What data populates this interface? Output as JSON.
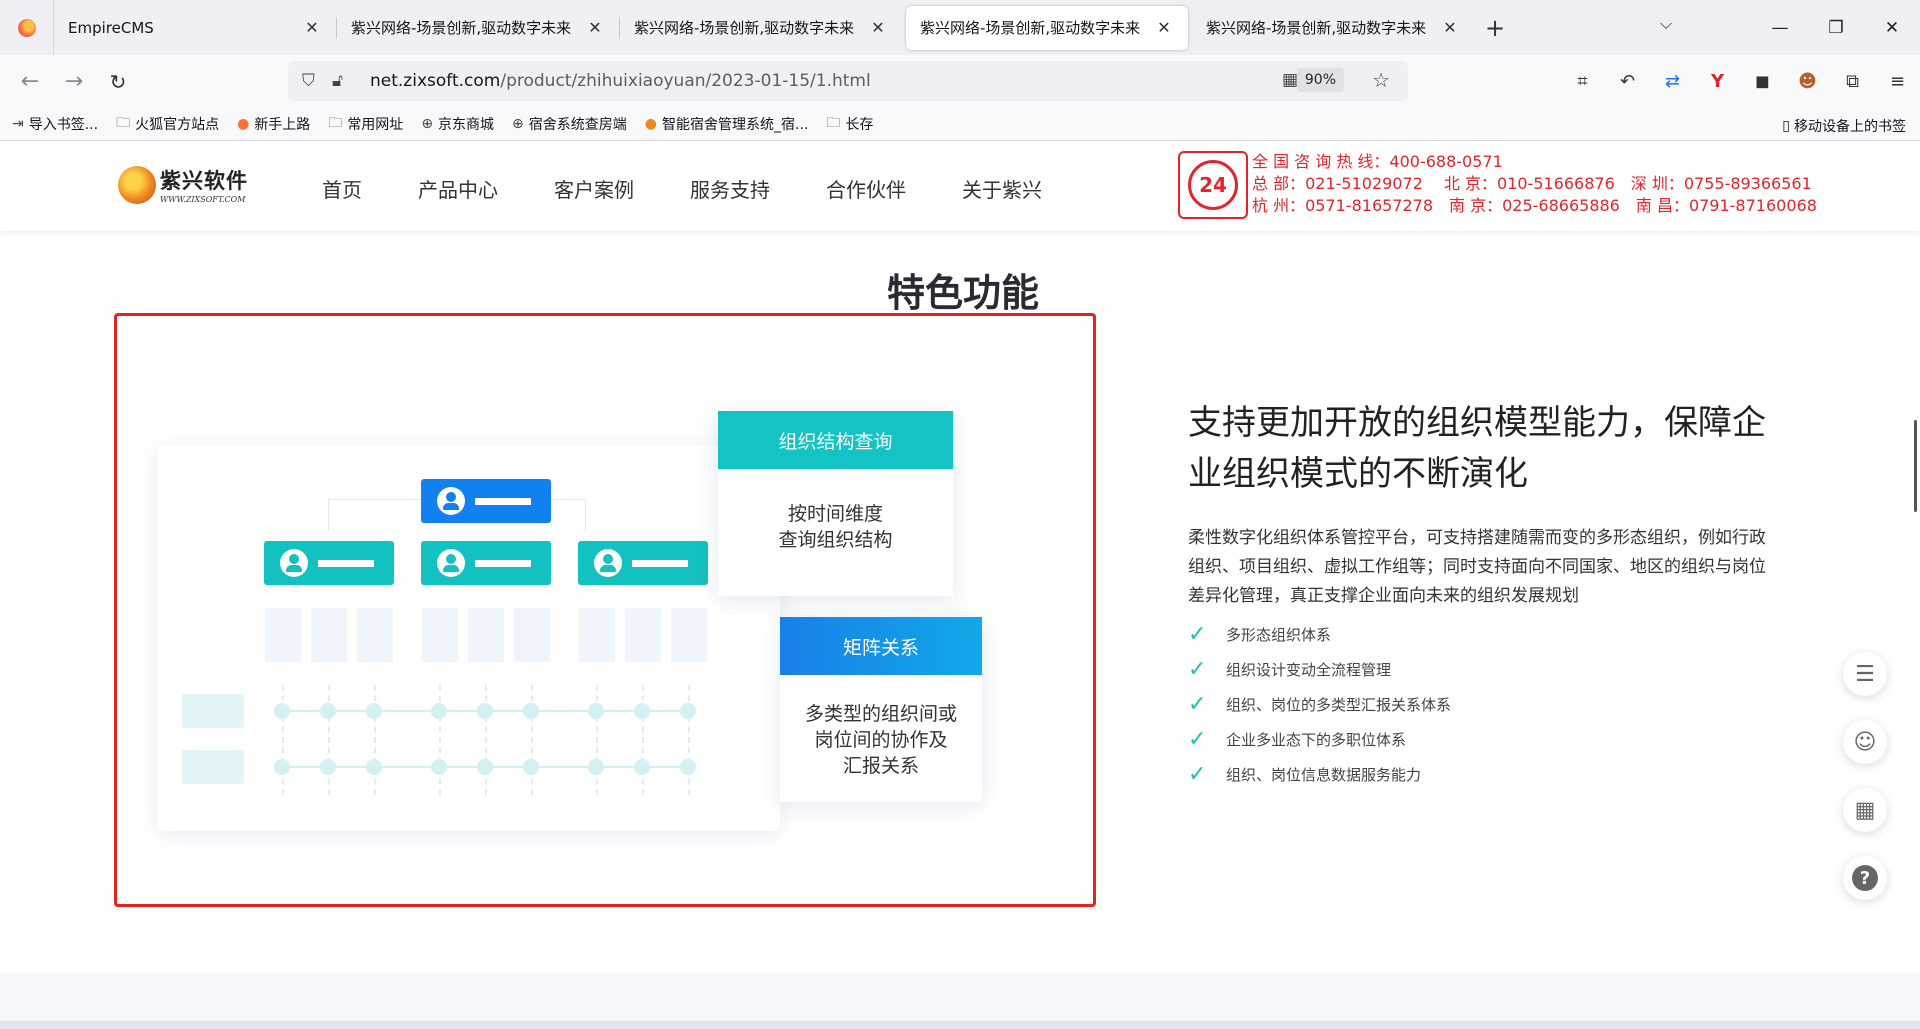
{
  "browser": {
    "tabs": [
      {
        "label": "EmpireCMS",
        "active": false
      },
      {
        "label": "紫兴网络-场景创新,驱动数字未来",
        "active": false
      },
      {
        "label": "紫兴网络-场景创新,驱动数字未来",
        "active": false
      },
      {
        "label": "紫兴网络-场景创新,驱动数字未来",
        "active": true
      },
      {
        "label": "紫兴网络-场景创新,驱动数字未来",
        "active": false
      }
    ],
    "url_host": "net.zixsoft.com",
    "url_path": "/product/zhihuixiaoyuan/2023-01-15/1.html",
    "zoom": "90%",
    "bookmarks": [
      {
        "label": "导入书签...",
        "icon": "import-icon"
      },
      {
        "label": "火狐官方站点",
        "icon": "folder-icon"
      },
      {
        "label": "新手上路",
        "icon": "firefox-icon"
      },
      {
        "label": "常用网址",
        "icon": "folder-icon"
      },
      {
        "label": "京东商城",
        "icon": "globe-icon"
      },
      {
        "label": "宿舍系统查房端",
        "icon": "globe-icon"
      },
      {
        "label": "智能宿舍管理系统_宿...",
        "icon": "site-icon"
      },
      {
        "label": "长存",
        "icon": "folder-icon"
      }
    ],
    "mobile_bookmarks": "移动设备上的书签"
  },
  "header": {
    "logo_cn": "紫兴软件",
    "logo_en": "WWW.ZIXSOFT.COM",
    "nav": [
      "首页",
      "产品中心",
      "客户案例",
      "服务支持",
      "合作伙伴",
      "关于紫兴"
    ],
    "hotline_badge": "24",
    "hotline": [
      "全 国 咨 询 热 线：400-688-0571",
      "总 部：021-51029072　 北 京：010-51666876　深 圳：0755-89366561",
      "杭 州：0571-81657278　南 京：025-68665886　南 昌：0791-87160068"
    ]
  },
  "section": {
    "title": "特色功能",
    "card1": {
      "title": "组织结构查询",
      "body_line1": "按时间维度",
      "body_line2": "查询组织结构"
    },
    "card2": {
      "title": "矩阵关系",
      "body_line1": "多类型的组织间或",
      "body_line2": "岗位间的协作及",
      "body_line3": "汇报关系"
    },
    "heading": "支持更加开放的组织模型能力，保障企业组织模式的不断演化",
    "description": "柔性数字化组织体系管控平台，可支持搭建随需而变的多形态组织，例如行政组织、项目组织、虚拟工作组等；同时支持面向不同国家、地区的组织与岗位差异化管理，真正支撑企业面向未来的组织发展规划",
    "features": [
      "多形态组织体系",
      "组织设计变动全流程管理",
      "组织、岗位的多类型汇报关系体系",
      "企业多业态下的多职位体系",
      "组织、岗位信息数据服务能力"
    ]
  },
  "colors": {
    "brand_red": "#e0262c",
    "teal": "#14c3c3",
    "blue": "#1181f1",
    "frame_red": "#e5231c"
  }
}
